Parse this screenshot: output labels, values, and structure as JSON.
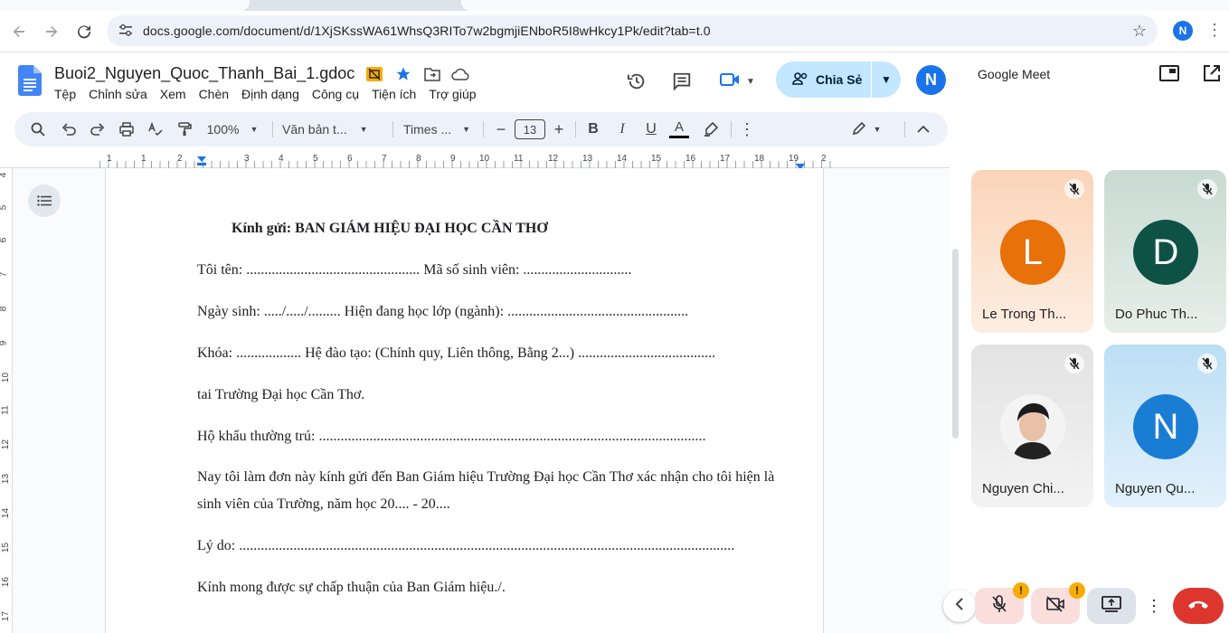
{
  "browser": {
    "url": "docs.google.com/document/d/1XjSKssWA61WhsQ3RITo7w2bgmjiENboR5I8wHkcy1Pk/edit?tab=t.0",
    "profile_initial": "N"
  },
  "docs": {
    "title": "Buoi2_Nguyen_Quoc_Thanh_Bai_1.gdoc",
    "menu": [
      "Tệp",
      "Chỉnh sửa",
      "Xem",
      "Chèn",
      "Định dạng",
      "Công cụ",
      "Tiện ích",
      "Trợ giúp"
    ],
    "share_label": "Chia Sẻ",
    "user_initial": "N",
    "toolbar": {
      "zoom": "100%",
      "style": "Văn bản t...",
      "font": "Times ...",
      "font_size": "13"
    },
    "ruler_labels": [
      "1",
      "1",
      "2",
      "3",
      "4",
      "5",
      "6",
      "7",
      "8",
      "9",
      "10",
      "11",
      "12",
      "13",
      "14",
      "15",
      "16",
      "17",
      "18",
      "19",
      "2"
    ],
    "vruler_labels": [
      "4",
      "5",
      "6",
      "7",
      "8",
      "9",
      "10",
      "11",
      "12",
      "13",
      "14",
      "15",
      "16",
      "17"
    ]
  },
  "document": {
    "heading": "Kính gửi: BAN GIÁM HIỆU  ĐẠI HỌC CẦN THƠ",
    "lines": [
      "Tôi tên: ................................................   Mã số sinh viên: ..............................",
      "Ngày sinh: ...../...../.........   Hiện đang học lớp (ngành): ..................................................",
      "Khóa: ..................   Hệ đào tạo: (Chính quy, Liên thông, Bằng 2...) ......................................",
      "tai Trường Đại học Cần Thơ.",
      "Hộ khẩu thường trú: ...........................................................................................................",
      "Nay tôi làm đơn này kính gửi đến Ban Giám hiệu Trường Đại học Cần Thơ xác nhận cho tôi hiện là",
      "sinh viên của Trường, năm học 20.... - 20....",
      "Lý do: .........................................................................................................................................",
      "Kính mong được sự chấp thuận của Ban Giám hiệu./."
    ]
  },
  "meet": {
    "title": "Google Meet",
    "participants": [
      {
        "name": "Le Trong Th...",
        "initial": "L",
        "color": "#e8710a"
      },
      {
        "name": "Do Phuc Th...",
        "initial": "D",
        "color": "#0d5245"
      },
      {
        "name": "Nguyen Chi...",
        "initial": "",
        "color": "#f1f3f4"
      },
      {
        "name": "Nguyen Qu...",
        "initial": "N",
        "color": "#1a7dd4"
      }
    ],
    "warning_badge": "!"
  },
  "icons": [
    "back-icon",
    "forward-icon",
    "reload-icon",
    "tune-icon",
    "star-icon",
    "docs-logo-icon",
    "history-icon",
    "comment-icon",
    "video-icon",
    "search-icon",
    "undo-icon",
    "redo-icon",
    "print-icon",
    "spellcheck-icon",
    "paint-format-icon",
    "bold-icon",
    "italic-icon",
    "underline-icon",
    "text-color-icon",
    "highlight-icon",
    "pencil-icon",
    "mic-off-icon",
    "camera-off-icon",
    "present-icon",
    "end-call-icon"
  ]
}
